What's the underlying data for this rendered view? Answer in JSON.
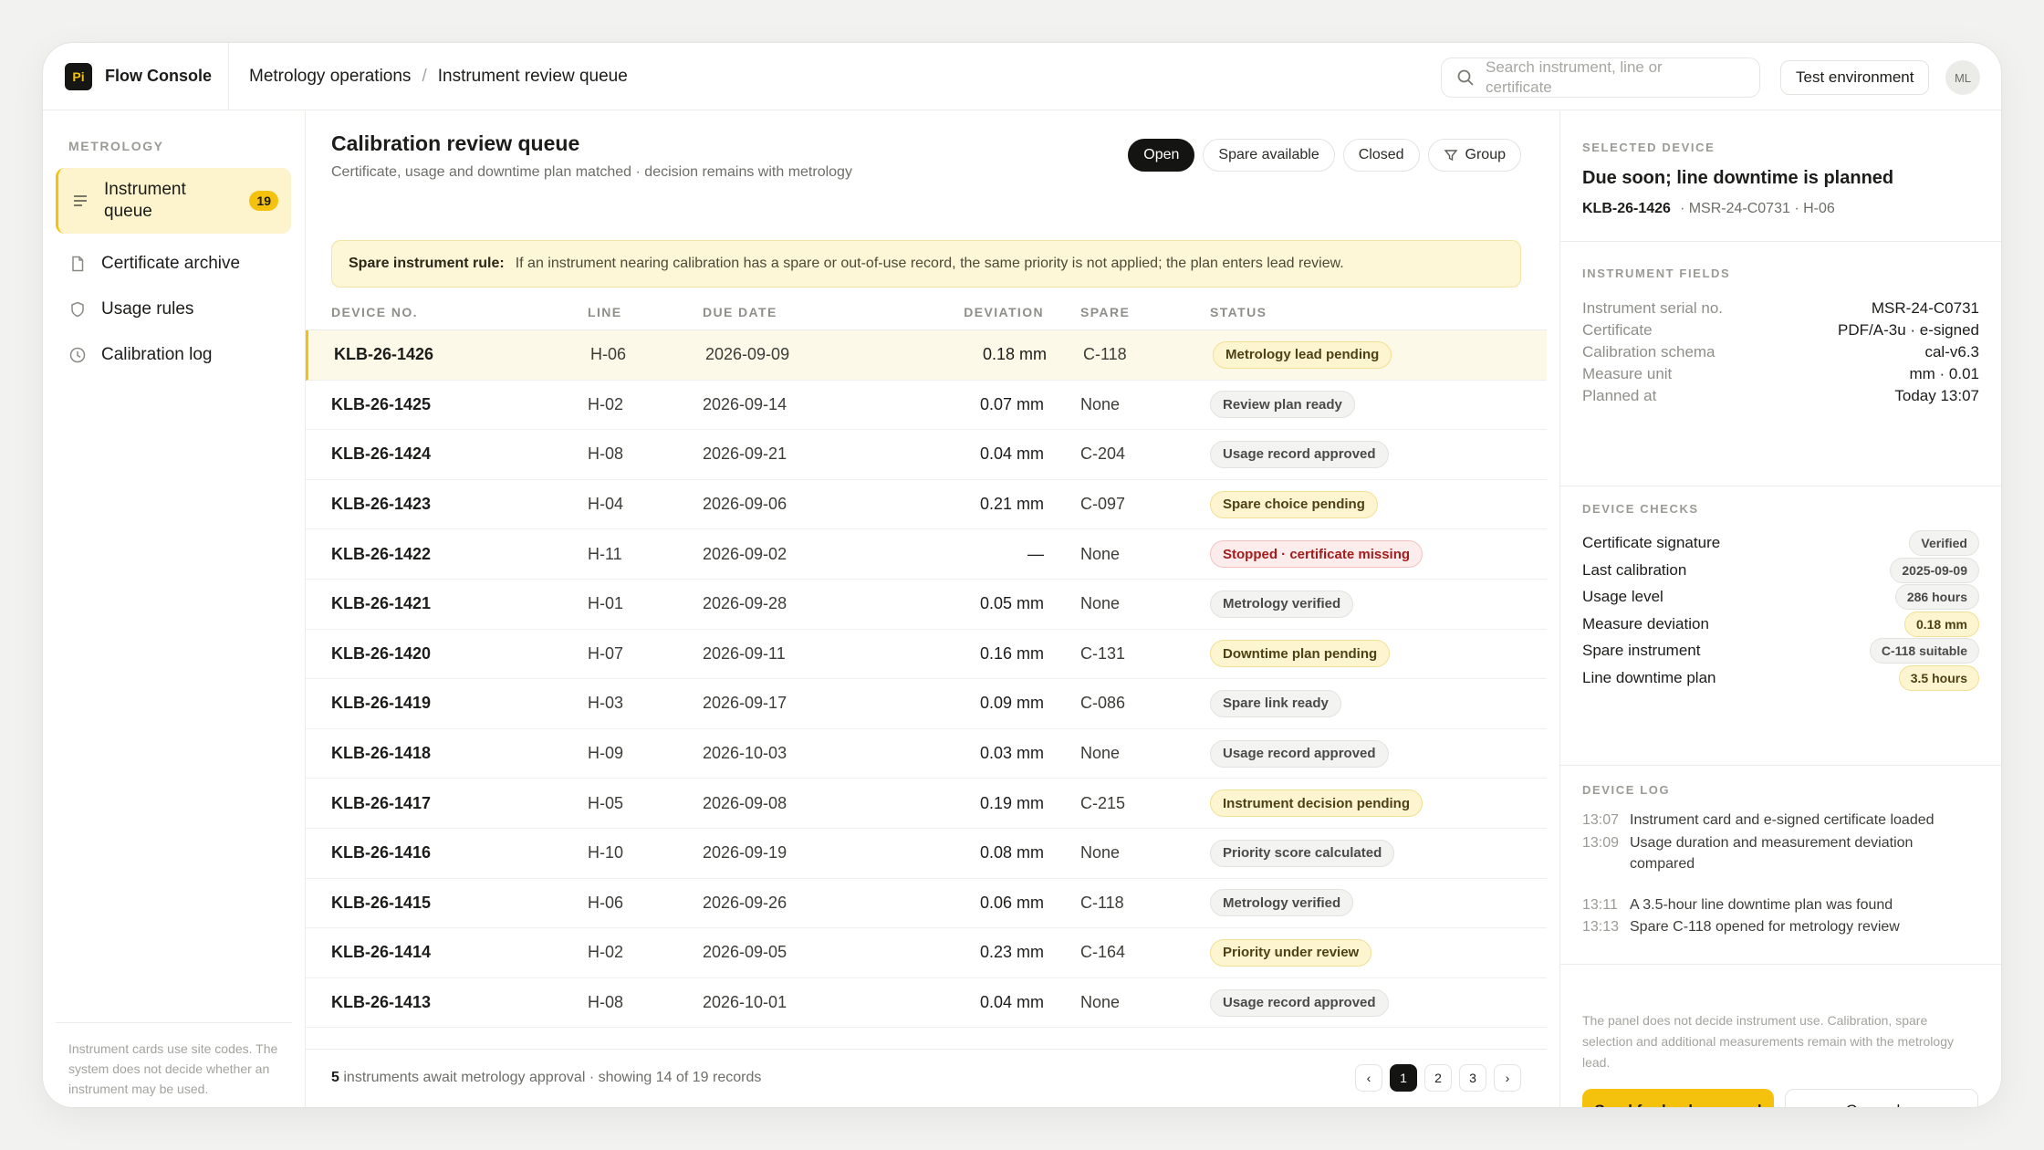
{
  "app": {
    "logo_text": "Pi",
    "name": "Flow Console"
  },
  "breadcrumb": {
    "parent": "Metrology operations",
    "separator": "/",
    "current": "Instrument review queue"
  },
  "search": {
    "placeholder": "Search instrument, line or certificate",
    "icon": "search-icon"
  },
  "environment_label": "Test environment",
  "user_initials": "ML",
  "sidebar": {
    "heading": "METROLOGY",
    "items": [
      {
        "label": "Instrument queue",
        "icon": "list-icon",
        "badge": "19",
        "active": true
      },
      {
        "label": "Certificate archive",
        "icon": "document-icon"
      },
      {
        "label": "Usage rules",
        "icon": "shield-icon"
      },
      {
        "label": "Calibration log",
        "icon": "clock-icon"
      }
    ],
    "note": "Instrument cards use site codes. The system does not decide whether an instrument may be used."
  },
  "main": {
    "title": "Calibration review queue",
    "subtitle": "Certificate, usage and downtime plan matched · decision remains with metrology",
    "filters": [
      "Open",
      "Spare available",
      "Closed",
      "Group"
    ],
    "active_filter": "Open",
    "rule_title": "Spare instrument rule:",
    "rule_text": "If an instrument nearing calibration has a spare or out-of-use record, the same priority is not applied; the plan enters lead review.",
    "columns": [
      "DEVICE NO.",
      "LINE",
      "DUE DATE",
      "DEVIATION",
      "SPARE",
      "STATUS"
    ],
    "rows": [
      {
        "device": "KLB-26-1426",
        "line": "H-06",
        "due": "2026-09-09",
        "deviation": "0.18 mm",
        "spare": "C-118",
        "status": "Metrology lead pending",
        "tone": "yellow"
      },
      {
        "device": "KLB-26-1425",
        "line": "H-02",
        "due": "2026-09-14",
        "deviation": "0.07 mm",
        "spare": "None",
        "status": "Review plan ready",
        "tone": "gray"
      },
      {
        "device": "KLB-26-1424",
        "line": "H-08",
        "due": "2026-09-21",
        "deviation": "0.04 mm",
        "spare": "C-204",
        "status": "Usage record approved",
        "tone": "gray"
      },
      {
        "device": "KLB-26-1423",
        "line": "H-04",
        "due": "2026-09-06",
        "deviation": "0.21 mm",
        "spare": "C-097",
        "status": "Spare choice pending",
        "tone": "yellow"
      },
      {
        "device": "KLB-26-1422",
        "line": "H-11",
        "due": "2026-09-02",
        "deviation": "—",
        "spare": "None",
        "status": "Stopped · certificate missing",
        "tone": "red"
      },
      {
        "device": "KLB-26-1421",
        "line": "H-01",
        "due": "2026-09-28",
        "deviation": "0.05 mm",
        "spare": "None",
        "status": "Metrology verified",
        "tone": "gray"
      },
      {
        "device": "KLB-26-1420",
        "line": "H-07",
        "due": "2026-09-11",
        "deviation": "0.16 mm",
        "spare": "C-131",
        "status": "Downtime plan pending",
        "tone": "yellow"
      },
      {
        "device": "KLB-26-1419",
        "line": "H-03",
        "due": "2026-09-17",
        "deviation": "0.09 mm",
        "spare": "C-086",
        "status": "Spare link ready",
        "tone": "gray"
      },
      {
        "device": "KLB-26-1418",
        "line": "H-09",
        "due": "2026-10-03",
        "deviation": "0.03 mm",
        "spare": "None",
        "status": "Usage record approved",
        "tone": "gray"
      },
      {
        "device": "KLB-26-1417",
        "line": "H-05",
        "due": "2026-09-08",
        "deviation": "0.19 mm",
        "spare": "C-215",
        "status": "Instrument decision pending",
        "tone": "yellow"
      },
      {
        "device": "KLB-26-1416",
        "line": "H-10",
        "due": "2026-09-19",
        "deviation": "0.08 mm",
        "spare": "None",
        "status": "Priority score calculated",
        "tone": "gray"
      },
      {
        "device": "KLB-26-1415",
        "line": "H-06",
        "due": "2026-09-26",
        "deviation": "0.06 mm",
        "spare": "C-118",
        "status": "Metrology verified",
        "tone": "gray"
      },
      {
        "device": "KLB-26-1414",
        "line": "H-02",
        "due": "2026-09-05",
        "deviation": "0.23 mm",
        "spare": "C-164",
        "status": "Priority under review",
        "tone": "yellow"
      },
      {
        "device": "KLB-26-1413",
        "line": "H-08",
        "due": "2026-10-01",
        "deviation": "0.04 mm",
        "spare": "None",
        "status": "Usage record approved",
        "tone": "gray"
      }
    ],
    "footer_count": "5",
    "footer_text": "instruments await metrology approval · showing 14 of 19 records",
    "pages": [
      "‹",
      "1",
      "2",
      "3",
      "›"
    ],
    "current_page": "1"
  },
  "panel": {
    "heading": "SELECTED DEVICE",
    "title": "Due soon; line downtime is planned",
    "device": "KLB-26-1426",
    "device_meta": "· MSR-24-C0731 · H-06",
    "fields_heading": "INSTRUMENT FIELDS",
    "fields": [
      {
        "k": "Instrument serial no.",
        "v": "MSR-24-C0731"
      },
      {
        "k": "Certificate",
        "v": "PDF/A-3u · e-signed"
      },
      {
        "k": "Calibration schema",
        "v": "cal-v6.3"
      },
      {
        "k": "Measure unit",
        "v": "mm · 0.01"
      },
      {
        "k": "Planned at",
        "v": "Today 13:07"
      }
    ],
    "checks_heading": "DEVICE CHECKS",
    "checks": [
      {
        "k": "Certificate signature",
        "v": "Verified",
        "tone": "gray"
      },
      {
        "k": "Last calibration",
        "v": "2025-09-09",
        "tone": "gray"
      },
      {
        "k": "Usage level",
        "v": "286 hours",
        "tone": "gray"
      },
      {
        "k": "Measure deviation",
        "v": "0.18 mm",
        "tone": "yellow"
      },
      {
        "k": "Spare instrument",
        "v": "C-118 suitable",
        "tone": "gray"
      },
      {
        "k": "Line downtime plan",
        "v": "3.5 hours",
        "tone": "yellow"
      }
    ],
    "log_heading": "DEVICE LOG",
    "log": [
      {
        "t": "13:07",
        "m": "Instrument card and e-signed certificate loaded"
      },
      {
        "t": "13:09",
        "m": "Usage duration and measurement deviation compared"
      },
      {
        "t": "13:11",
        "m": "A 3.5-hour line downtime plan was found"
      },
      {
        "t": "13:13",
        "m": "Spare C-118 opened for metrology review"
      }
    ],
    "note": "The panel does not decide instrument use. Calibration, spare selection and additional measurements remain with the metrology lead.",
    "primary_button": "Send for lead approval",
    "secondary_button": "Open plan"
  },
  "colors": {
    "accent": "#f4c20d",
    "dark": "#141412",
    "danger": "#a31d1d"
  }
}
